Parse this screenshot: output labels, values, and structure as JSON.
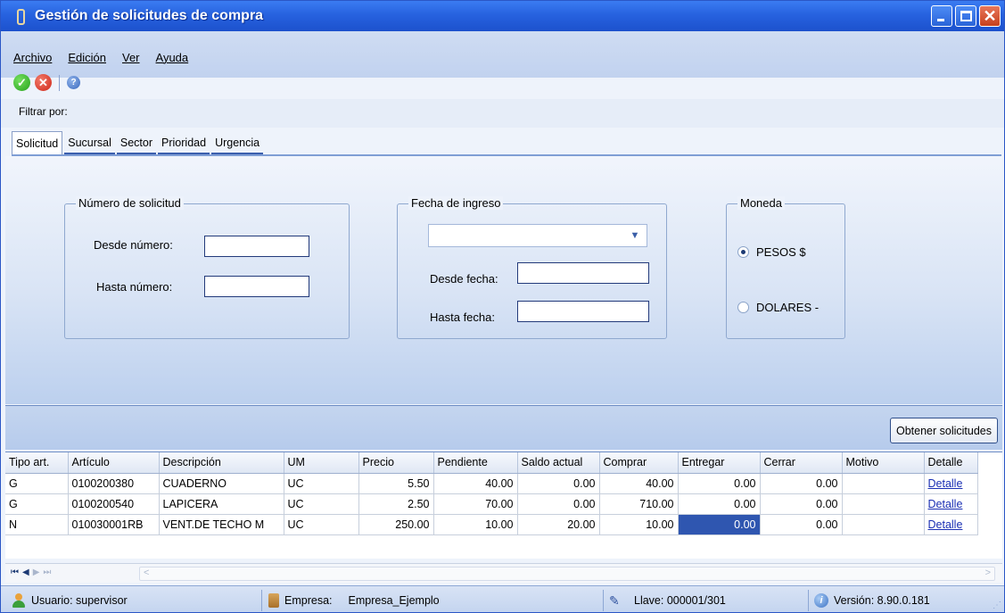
{
  "window": {
    "title": "Gestión de solicitudes de compra"
  },
  "menu": {
    "items": [
      "Archivo",
      "Edición",
      "Ver",
      "Ayuda"
    ]
  },
  "toolbar": {
    "icons": [
      "ok-icon",
      "cancel-icon",
      "help-icon"
    ]
  },
  "filter": {
    "label": "Filtrar por:",
    "tabs": [
      "Solicitud",
      "Sucursal",
      "Sector",
      "Prioridad",
      "Urgencia"
    ],
    "active_tab": "Solicitud"
  },
  "groups": {
    "numero": {
      "legend": "Número de solicitud",
      "desde_label": "Desde número:",
      "desde_value": "",
      "hasta_label": "Hasta número:",
      "hasta_value": ""
    },
    "fecha": {
      "legend": "Fecha de ingreso",
      "combo_value": "",
      "desde_label": "Desde fecha:",
      "desde_value": "",
      "hasta_label": "Hasta fecha:",
      "hasta_value": ""
    },
    "moneda": {
      "legend": "Moneda",
      "options": [
        "PESOS $",
        "DOLARES -"
      ],
      "selected": "PESOS $"
    }
  },
  "actions": {
    "obtener": "Obtener solicitudes"
  },
  "grid": {
    "columns": [
      "Tipo art.",
      "Artículo",
      "Descripción",
      "UM",
      "Precio",
      "Pendiente",
      "Saldo actual",
      "Comprar",
      "Entregar",
      "Cerrar",
      "Motivo",
      "Detalle"
    ],
    "rows": [
      [
        "G",
        "0100200380",
        "CUADERNO",
        "UC",
        "5.50",
        "40.00",
        "0.00",
        "40.00",
        "0.00",
        "0.00",
        "",
        "Detalle"
      ],
      [
        "G",
        "0100200540",
        "LAPICERA",
        "UC",
        "2.50",
        "70.00",
        "0.00",
        "710.00",
        "0.00",
        "0.00",
        "",
        "Detalle"
      ],
      [
        "N",
        "010030001RB",
        "VENT.DE TECHO M",
        "UC",
        "250.00",
        "10.00",
        "20.00",
        "10.00",
        "0.00",
        "0.00",
        "",
        "Detalle"
      ]
    ]
  },
  "status": {
    "usuario": "Usuario: supervisor",
    "empresa_label": "Empresa:",
    "empresa_value": "Empresa_Ejemplo",
    "llave": "Llave: 000001/301",
    "version": "Versión: 8.90.0.181"
  },
  "colors": {
    "titlebar": "#2762df",
    "selection": "#2f56b0",
    "link": "#1a2fb4"
  }
}
